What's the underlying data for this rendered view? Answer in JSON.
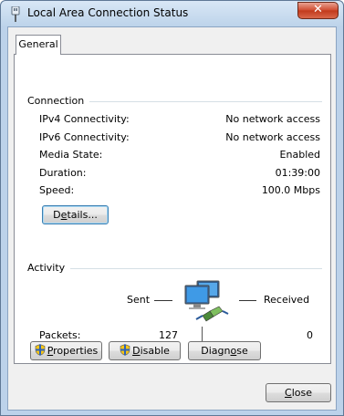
{
  "window": {
    "title": "Local Area Connection Status",
    "close_glyph": "✕"
  },
  "tabs": [
    {
      "label": "General",
      "selected": true
    }
  ],
  "connection": {
    "heading": "Connection",
    "rows": [
      {
        "label": "IPv4 Connectivity:",
        "value": "No network access"
      },
      {
        "label": "IPv6 Connectivity:",
        "value": "No network access"
      },
      {
        "label": "Media State:",
        "value": "Enabled"
      },
      {
        "label": "Duration:",
        "value": "01:39:00"
      },
      {
        "label": "Speed:",
        "value": "100.0 Mbps"
      }
    ],
    "details_button": {
      "prefix": "D",
      "accel": "e",
      "rest": "tails..."
    }
  },
  "activity": {
    "heading": "Activity",
    "sent_label": "Sent",
    "received_label": "Received",
    "packets_label": "Packets:",
    "packets_sent": "127",
    "packets_received": "0"
  },
  "buttons": {
    "properties": {
      "accel": "P",
      "rest": "roperties"
    },
    "disable": {
      "accel": "D",
      "rest": "isable"
    },
    "diagnose": {
      "prefix": "Diagn",
      "accel": "o",
      "rest": "se"
    },
    "close": {
      "accel": "C",
      "rest": "lose"
    }
  },
  "icons": {
    "window": "network-adapter-icon",
    "activity": "network-computers-icon",
    "shield": "uac-shield-icon"
  },
  "colors": {
    "window_frame": "#bcd2ea",
    "close_button": "#c1391b",
    "client_bg": "#f0f0f0",
    "panel_bg": "#ffffff"
  }
}
